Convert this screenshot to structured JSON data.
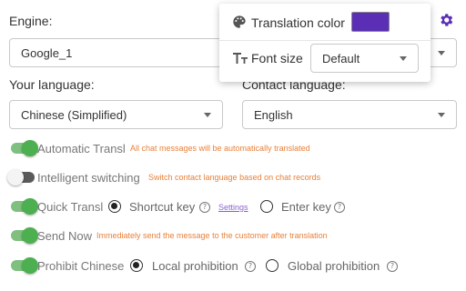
{
  "engine": {
    "label": "Engine:",
    "value": "Google_1"
  },
  "your_language": {
    "label": "Your language:",
    "value": "Chinese (Simplified)"
  },
  "contact_language": {
    "label": "Contact language:",
    "value": "English"
  },
  "settings_icon": "gear-icon",
  "popup": {
    "translation_color_label": "Translation color",
    "translation_color_value": "#5a2fb5",
    "font_size_label": "Font size",
    "font_size_value": "Default"
  },
  "options": {
    "automatic": {
      "label": "Automatic Transl",
      "hint": "All chat messages will be automatically translated",
      "enabled": true
    },
    "intelligent": {
      "label": "Intelligent switching",
      "hint": "Switch contact language based on chat records",
      "enabled": false
    },
    "quick": {
      "label": "Quick Transl",
      "enabled": true,
      "radio_1": "Shortcut key",
      "settings_link": "Settings",
      "radio_2": "Enter key",
      "selected": "Shortcut key"
    },
    "send_now": {
      "label": "Send Now",
      "hint": "Immediately send the message to the customer after translation",
      "enabled": true
    },
    "prohibit": {
      "label": "Prohibit Chinese",
      "enabled": true,
      "radio_1": "Local prohibition",
      "radio_2": "Global prohibition",
      "selected": "Local prohibition"
    }
  },
  "help_glyph": "?",
  "colors": {
    "accent": "#5a2fb5",
    "toggle_on": "#4caf50",
    "hint": "#e8803a",
    "link": "#8a63d2"
  }
}
